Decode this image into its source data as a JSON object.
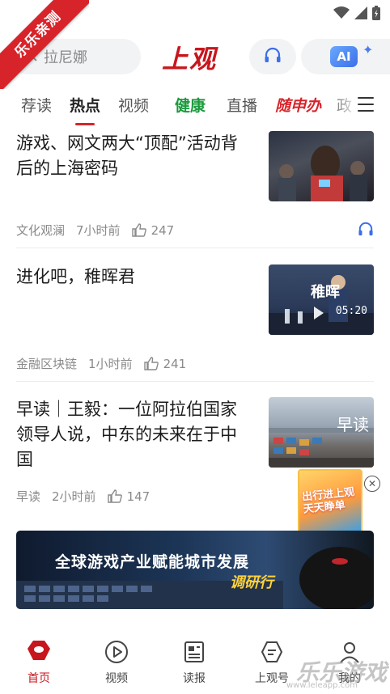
{
  "ribbon": {
    "text": "乐乐亲测"
  },
  "header": {
    "search_placeholder": "拉尼娜",
    "logo": "上观",
    "ai_label": "AI"
  },
  "tabs": [
    {
      "label": "荐读"
    },
    {
      "label": "热点"
    },
    {
      "label": "视频"
    },
    {
      "label": "健康"
    },
    {
      "label": "直播"
    },
    {
      "label": "随申办"
    },
    {
      "label": "政"
    }
  ],
  "articles": [
    {
      "title": "游戏、网文两大“顶配”活动背后的上海密码",
      "source": "文化观澜",
      "time": "7小时前",
      "likes": "247"
    },
    {
      "title": "进化吧，稚晖君",
      "source": "金融区块链",
      "time": "1小时前",
      "likes": "241",
      "duration": "05:20"
    },
    {
      "title": "早读｜王毅：一位阿拉伯国家领导人说，中东的未来在于中国",
      "source": "早读",
      "time": "2小时前",
      "likes": "147"
    }
  ],
  "thumb2_text": "稚晖",
  "thumb3_text": "早读",
  "float_ad": {
    "text": "出行进上观 天天睁单"
  },
  "banner": {
    "title": "全球游戏产业赋能城市发展",
    "subtitle": "调研行"
  },
  "bottom_nav": [
    {
      "label": "首页"
    },
    {
      "label": "视频"
    },
    {
      "label": "读报"
    },
    {
      "label": "上观号"
    },
    {
      "label": "我的"
    }
  ],
  "watermark": {
    "text": "乐乐游戏",
    "url": "www.leleapp.com"
  },
  "colors": {
    "accent": "#d7242a",
    "health": "#1a9a3c",
    "ai": "#3b6fe8"
  }
}
